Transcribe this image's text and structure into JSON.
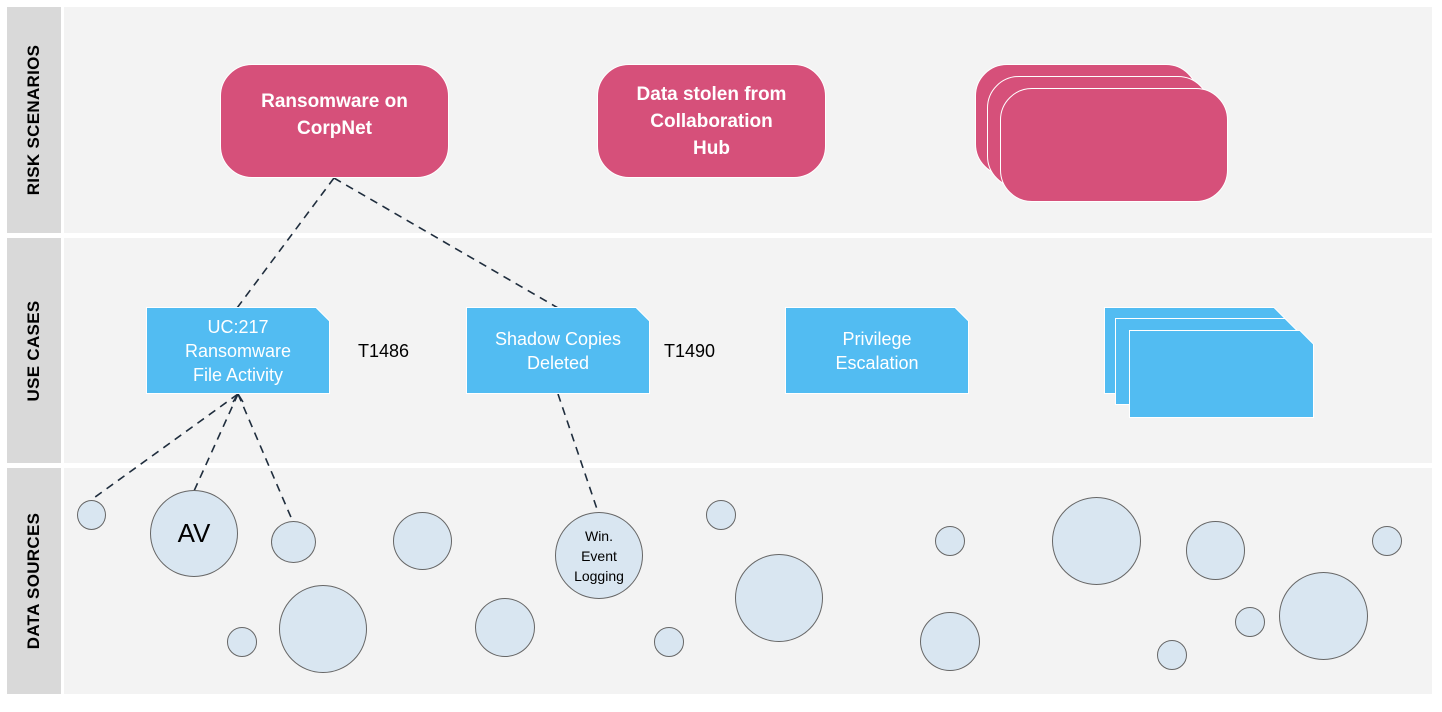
{
  "lanes": [
    {
      "id": "risk",
      "label": "RISK SCENARIOS"
    },
    {
      "id": "usecases",
      "label": "USE CASES"
    },
    {
      "id": "datasources",
      "label": "DATA SOURCES"
    }
  ],
  "risk_scenarios": [
    {
      "label": "Ransomware on\nCorpNet"
    },
    {
      "label": "Data stolen from\nCollaboration\nHub"
    },
    {
      "label": "",
      "stacked": true
    }
  ],
  "use_cases": [
    {
      "label": "UC:217\nRansomware\nFile Activity",
      "technique": "T1486"
    },
    {
      "label": "Shadow Copies\nDeleted",
      "technique": "T1490"
    },
    {
      "label": "Privilege\nEscalation",
      "technique": ""
    },
    {
      "label": "",
      "stacked": true
    }
  ],
  "data_sources": [
    {
      "label": ""
    },
    {
      "label": "AV"
    },
    {
      "label": ""
    },
    {
      "label": ""
    },
    {
      "label": "Win.\nEvent\nLogging"
    },
    {
      "label": ""
    },
    {
      "label": ""
    },
    {
      "label": ""
    },
    {
      "label": ""
    },
    {
      "label": ""
    },
    {
      "label": ""
    },
    {
      "label": ""
    },
    {
      "label": ""
    },
    {
      "label": ""
    },
    {
      "label": ""
    },
    {
      "label": ""
    },
    {
      "label": ""
    },
    {
      "label": ""
    }
  ],
  "connections": [
    {
      "from": "risk-ransomware-corpnet",
      "to": "uc-ransomware-file-activity"
    },
    {
      "from": "risk-ransomware-corpnet",
      "to": "uc-shadow-copies-deleted"
    },
    {
      "from": "uc-ransomware-file-activity",
      "to": "ds-1"
    },
    {
      "from": "uc-ransomware-file-activity",
      "to": "ds-av"
    },
    {
      "from": "uc-ransomware-file-activity",
      "to": "ds-3"
    },
    {
      "from": "uc-shadow-copies-deleted",
      "to": "ds-win-event-logging"
    }
  ],
  "colors": {
    "risk": "#d6507a",
    "use_case": "#52bcf2",
    "data_source_fill": "#d9e6f1",
    "data_source_stroke": "#666666",
    "lane_label_bg": "#d9d9d9",
    "lane_body_bg": "#f3f3f3",
    "connector": "#1f2d3d"
  }
}
